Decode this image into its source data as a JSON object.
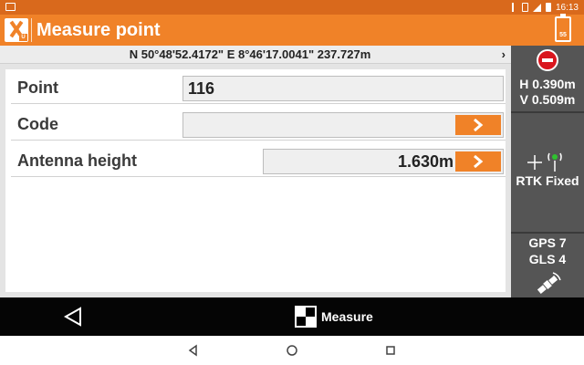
{
  "status_bar": {
    "time": "16:13",
    "icons": [
      "image-icon",
      "bluetooth-icon",
      "vibrate-icon",
      "signal-icon",
      "battery-icon"
    ]
  },
  "header": {
    "title": "Measure point",
    "battery_level": "55",
    "logo_icon": "app-logo-icon"
  },
  "coordinates": {
    "text": "N 50°48'52.4172\" E 8°46'17.0041\" 237.727m",
    "chevron": "›"
  },
  "form": {
    "point": {
      "label": "Point",
      "value": "116"
    },
    "code": {
      "label": "Code",
      "value": ""
    },
    "antenna": {
      "label": "Antenna height",
      "value": "1.630m"
    }
  },
  "side_panel": {
    "precision_h": "H 0.390m",
    "precision_v": "V 0.509m",
    "rtk_status": "RTK Fixed",
    "gps_count": "GPS 7",
    "gls_count": "GLS 4"
  },
  "action_bar": {
    "measure_label": "Measure"
  },
  "colors": {
    "accent": "#f08228",
    "status_bar": "#d9691c",
    "side_panel": "#555555",
    "stop": "#d9161e"
  }
}
